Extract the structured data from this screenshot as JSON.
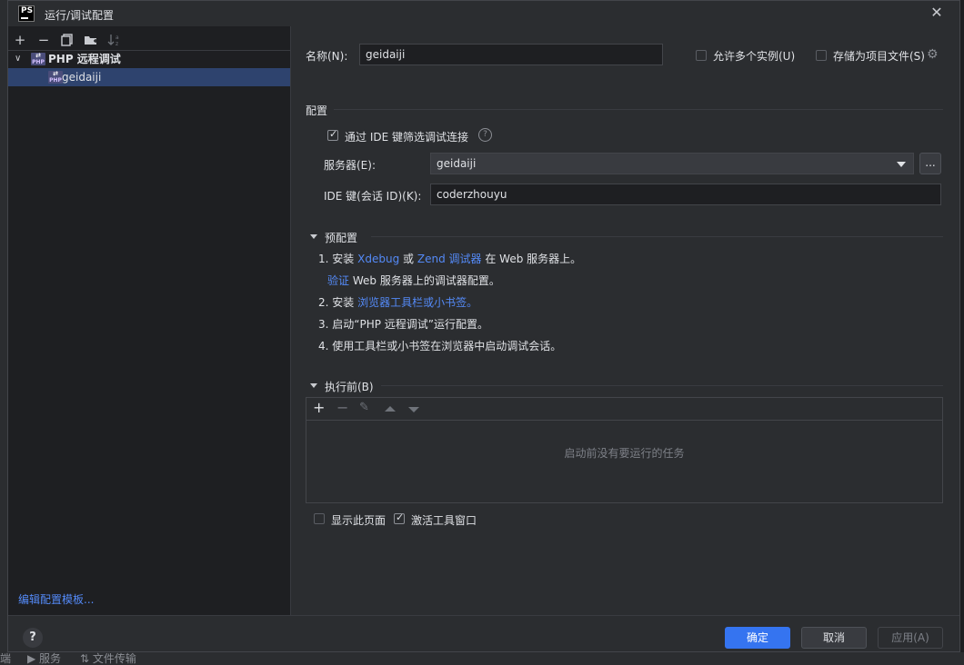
{
  "dialog": {
    "title": "运行/调试配置",
    "logo": "PS"
  },
  "toolbar": {
    "add_icon": "+",
    "remove_icon": "−",
    "copy_icon": "copy-icon",
    "folder_icon": "folder-add-icon",
    "sort_icon": "sort-alpha-icon"
  },
  "tree": {
    "group_label": "PHP 远程调试",
    "item_label": "geidaiji"
  },
  "edit_templates_link": "编辑配置模板...",
  "name_row": {
    "label": "名称(N):",
    "value": "geidaiji",
    "allow_parallel_label": "允许多个实例(U)",
    "store_as_file_label": "存储为项目文件(S)"
  },
  "config_section": {
    "title": "配置",
    "filter_checkbox_label": "通过 IDE 键筛选调试连接",
    "server_label": "服务器(E):",
    "server_value": "geidaiji",
    "ide_key_label": "IDE 键(会话 ID)(K):",
    "ide_key_value": "coderzhouyu",
    "browse_btn": "..."
  },
  "preconfig": {
    "title": "预配置",
    "step1_num": "1.",
    "step1_pre": "安装",
    "step1_xdebug": "Xdebug",
    "step1_or": "或",
    "step1_zend": "Zend 调试器",
    "step1_post": "在 Web 服务器上。",
    "step1b_link": "验证",
    "step1b_text": "Web 服务器上的调试器配置。",
    "step2_num": "2.",
    "step2_pre": "安装",
    "step2_link": "浏览器工具栏或小书签。",
    "step3": "3. 启动“PHP 远程调试”运行配置。",
    "step4": "4. 使用工具栏或小书签在浏览器中启动调试会话。"
  },
  "before_launch": {
    "title": "执行前(B)",
    "empty_text": "启动前没有要运行的任务",
    "show_page_label": "显示此页面",
    "activate_window_label": "激活工具窗口"
  },
  "footer": {
    "help": "?",
    "ok": "确定",
    "cancel": "取消",
    "apply": "应用(A)"
  },
  "ide_bottom": {
    "item1": "端",
    "item2": "服务",
    "item3": "文件传输"
  }
}
